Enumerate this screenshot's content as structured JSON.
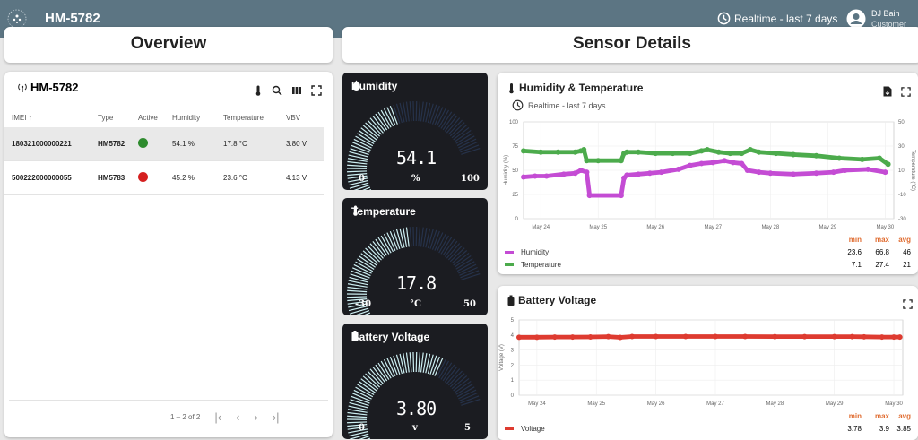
{
  "header": {
    "title": "HM-5782",
    "realtime": "Realtime - last 7 days",
    "user_name": "DJ Bain",
    "user_role": "Customer"
  },
  "overview": {
    "section_title": "Overview",
    "device_title": "HM-5782",
    "columns": [
      "IMEI",
      "Type",
      "Active",
      "Humidity",
      "Temperature",
      "VBV"
    ],
    "rows": [
      {
        "imei": "180321000000221",
        "type": "HM5782",
        "active_color": "#2e8b2e",
        "humidity": "54.1 %",
        "temperature": "17.8 °C",
        "vbv": "3.80 V"
      },
      {
        "imei": "500222000000055",
        "type": "HM5783",
        "active_color": "#d51f1f",
        "humidity": "45.2 %",
        "temperature": "23.6 °C",
        "vbv": "4.13 V"
      }
    ],
    "pagination": "1 – 2 of 2"
  },
  "sensor": {
    "section_title": "Sensor Details"
  },
  "gauges": [
    {
      "title": "Humidity",
      "value": "54.1",
      "unit": "%",
      "min": "0",
      "max": "100",
      "fraction": 0.541
    },
    {
      "title": "Temperature",
      "value": "17.8",
      "unit": "°C",
      "min": "-30",
      "max": "50",
      "fraction": 0.6
    },
    {
      "title": "Battery Voltage",
      "value": "3.80",
      "unit": "v",
      "min": "0",
      "max": "5",
      "fraction": 0.76
    }
  ],
  "colors": {
    "topbar": "#5c7583",
    "humidity": "#c44cd4",
    "temperature": "#4cab4c",
    "voltage": "#de3b30",
    "gauge_fill": "#cdeff2"
  },
  "chart_data": [
    {
      "type": "line",
      "title": "Humidity & Temperature",
      "subtitle": "Realtime - last 7 days",
      "x": [
        "May 24",
        "May 25",
        "May 26",
        "May 27",
        "May 28",
        "May 29",
        "May 30"
      ],
      "ylabel": "Humidity (%)",
      "ylim": [
        0,
        100
      ],
      "yticks": [
        0,
        25,
        50,
        75,
        100
      ],
      "y2label": "Temperature (°C)",
      "y2lim": [
        -30,
        50
      ],
      "y2ticks": [
        -30,
        -10,
        10,
        30,
        50
      ],
      "series": [
        {
          "name": "Humidity",
          "axis": "left",
          "x": [
            23.7,
            23.9,
            24.1,
            24.4,
            24.6,
            24.7,
            24.8,
            24.85,
            25.4,
            25.45,
            25.5,
            25.7,
            25.9,
            26.1,
            26.4,
            26.6,
            26.8,
            27.0,
            27.2,
            27.35,
            27.5,
            27.6,
            27.8,
            28.0,
            28.4,
            28.8,
            29.1,
            29.3,
            29.7,
            30.0
          ],
          "y": [
            43,
            44,
            44,
            46,
            47,
            50,
            48,
            24,
            24,
            42,
            45,
            46,
            47,
            48,
            51,
            55,
            57,
            58,
            60,
            58,
            57,
            50,
            48,
            47,
            46,
            47,
            48,
            50,
            51,
            48
          ],
          "stats": {
            "min": "23.6",
            "max": "66.8",
            "avg": "46"
          }
        },
        {
          "name": "Temperature",
          "axis": "right",
          "x": [
            23.7,
            24.0,
            24.3,
            24.6,
            24.7,
            24.75,
            24.8,
            25.0,
            25.4,
            25.45,
            25.5,
            25.7,
            26.0,
            26.3,
            26.6,
            26.8,
            26.9,
            27.1,
            27.3,
            27.5,
            27.65,
            27.8,
            28.1,
            28.4,
            28.8,
            29.2,
            29.6,
            29.9,
            30.05
          ],
          "y": [
            26,
            25,
            25,
            25,
            26,
            27,
            18,
            18,
            18,
            24,
            25,
            25,
            24,
            24,
            24,
            26,
            27,
            25,
            24,
            24,
            27,
            25,
            24,
            23,
            22,
            20,
            19,
            20,
            15
          ],
          "stats": {
            "min": "7.1",
            "max": "27.4",
            "avg": "21"
          }
        }
      ]
    },
    {
      "type": "line",
      "title": "Battery Voltage",
      "x": [
        "May 24",
        "May 25",
        "May 26",
        "May 27",
        "May 28",
        "May 29",
        "May 30"
      ],
      "ylabel": "Voltage (V)",
      "ylim": [
        0,
        5
      ],
      "yticks": [
        0,
        1,
        2,
        3,
        4,
        5
      ],
      "series": [
        {
          "name": "Voltage",
          "x": [
            23.7,
            24.0,
            24.3,
            24.6,
            24.9,
            25.2,
            25.4,
            25.6,
            26.0,
            26.5,
            27.0,
            27.5,
            28.0,
            28.5,
            29.0,
            29.3,
            29.5,
            29.8,
            30.0,
            30.1
          ],
          "y": [
            3.85,
            3.85,
            3.86,
            3.86,
            3.87,
            3.89,
            3.84,
            3.9,
            3.9,
            3.9,
            3.9,
            3.9,
            3.89,
            3.89,
            3.89,
            3.89,
            3.88,
            3.86,
            3.86,
            3.86
          ],
          "stats": {
            "min": "3.78",
            "max": "3.9",
            "avg": "3.85"
          }
        }
      ]
    }
  ],
  "stat_headers": {
    "min": "min",
    "max": "max",
    "avg": "avg"
  }
}
